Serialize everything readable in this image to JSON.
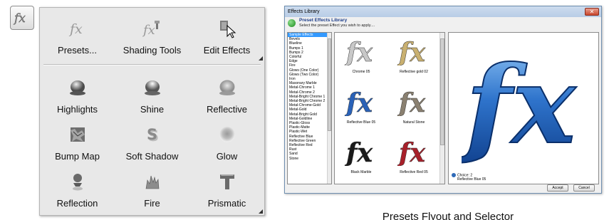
{
  "launcher": {
    "icon": "fx-icon"
  },
  "flyout": {
    "top_tools": [
      {
        "label": "Presets...",
        "icon": "fx-gray-icon"
      },
      {
        "label": "Shading Tools",
        "icon": "fx-shading-icon"
      },
      {
        "label": "Edit Effects",
        "icon": "edit-effects-icon"
      }
    ],
    "effects": [
      {
        "label": "Highlights",
        "icon": "highlights-icon"
      },
      {
        "label": "Shine",
        "icon": "shine-icon"
      },
      {
        "label": "Reflective",
        "icon": "reflective-icon"
      },
      {
        "label": "Bump Map",
        "icon": "bump-map-icon"
      },
      {
        "label": "Soft Shadow",
        "icon": "soft-shadow-icon"
      },
      {
        "label": "Glow",
        "icon": "glow-icon"
      },
      {
        "label": "Reflection",
        "icon": "reflection-icon"
      },
      {
        "label": "Fire",
        "icon": "fire-icon"
      },
      {
        "label": "Prismatic",
        "icon": "prismatic-icon"
      }
    ]
  },
  "dialog": {
    "title": "Effects Library",
    "close": "✕",
    "heading": "Preset Effects Library",
    "subheading": "Select the preset Effect you wish to apply....",
    "list_items": [
      "Sample Effects",
      "Bevels",
      "Blueline",
      "Bumps 1",
      "Bumps 2",
      "Colorful",
      "Edge",
      "Fire",
      "Glows (One Color)",
      "Glows (Two Color)",
      "Iron",
      "Masonary Marble",
      "Metal-Chrome 1",
      "Metal-Chrome 2",
      "Metal-Bright Chrome 1",
      "Metal-Bright Chrome 2",
      "Metal-Chrome-Gold",
      "Metal-Gold",
      "Metal-Bright Gold",
      "Metal-Goldline",
      "Plastic-Gloss",
      "Plastic-Matte",
      "Plastic-Wet",
      "Reflective Blue",
      "Reflective Green",
      "Reflective Red",
      "Rust",
      "Sand",
      "Stone"
    ],
    "selected_index": 0,
    "thumbnails": [
      {
        "caption": "Chrome 05",
        "color": "#c8c8c8"
      },
      {
        "caption": "Reflective gold 02",
        "color": "#c9b070"
      },
      {
        "caption": "Reflective Blue 05",
        "color": "#2a62b8"
      },
      {
        "caption": "Natural Stone",
        "color": "#8a8070"
      },
      {
        "caption": "Black Marble",
        "color": "#1a1a1a"
      },
      {
        "caption": "Reflective Red 05",
        "color": "#a8202a"
      }
    ],
    "choice_line1": "Choice: 2",
    "choice_line2": "Reflective Blue 05",
    "accept_label": "Accept",
    "cancel_label": "Cancel"
  },
  "caption": "Presets Flyout and Selector"
}
